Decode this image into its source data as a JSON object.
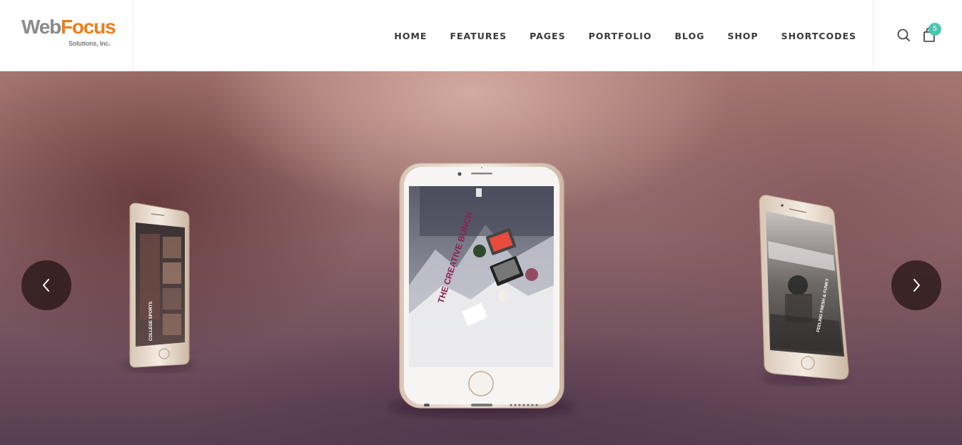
{
  "logo": {
    "part1": "Web",
    "part2": "Focus",
    "tagline": "Solutions, Inc."
  },
  "nav": {
    "items": [
      {
        "label": "HOME"
      },
      {
        "label": "FEATURES"
      },
      {
        "label": "PAGES"
      },
      {
        "label": "PORTFOLIO"
      },
      {
        "label": "BLOG"
      },
      {
        "label": "SHOP"
      },
      {
        "label": "SHORTCODES"
      }
    ]
  },
  "header": {
    "search_icon": "search-icon",
    "cart_icon": "shopping-bag-icon",
    "cart_count": "5"
  },
  "slider": {
    "prev_icon": "chevron-left-icon",
    "next_icon": "chevron-right-icon",
    "center_screen_title": "THE CREATIVE BUNCH",
    "left_screen_text": "COLLEGE SPORTS",
    "right_screen_text": "FEELING FRESH & FUNKY"
  },
  "colors": {
    "accent_orange": "#ef7d1a",
    "badge_teal": "#4cc6b1",
    "arrow_bg": "#2a1616",
    "nav_text": "#3a3a3a"
  }
}
